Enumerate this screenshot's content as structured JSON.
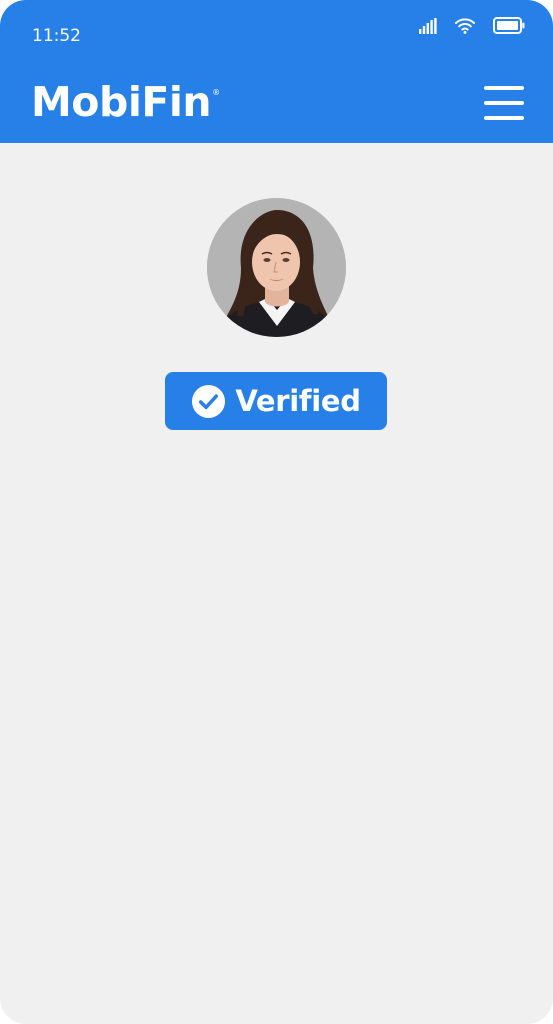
{
  "status_bar": {
    "time": "11:52",
    "icons": [
      "signal-icon",
      "wifi-icon",
      "battery-icon"
    ]
  },
  "header": {
    "logo_text": "MobiFin",
    "logo_mark": "®",
    "menu_icon": "hamburger-menu-icon"
  },
  "profile": {
    "avatar": "profile-photo",
    "badge_icon": "check-circle-icon",
    "badge_label": "Verified"
  },
  "colors": {
    "brand": "#2680e8",
    "background": "#f1f0f1",
    "text_on_brand": "#ffffff"
  }
}
